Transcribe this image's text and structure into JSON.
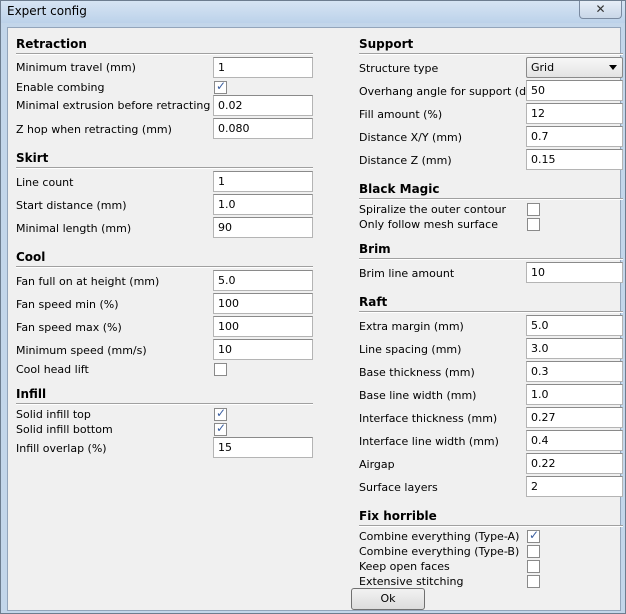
{
  "window": {
    "title": "Expert config",
    "close_glyph": "✕"
  },
  "left": {
    "retraction": {
      "title": "Retraction",
      "min_travel": {
        "label": "Minimum travel (mm)",
        "value": "1"
      },
      "enable_combing": {
        "label": "Enable combing",
        "checked": true
      },
      "min_extrusion": {
        "label": "Minimal extrusion before retracting (mm)",
        "value": "0.02"
      },
      "z_hop": {
        "label": "Z hop when retracting (mm)",
        "value": "0.080"
      }
    },
    "skirt": {
      "title": "Skirt",
      "line_count": {
        "label": "Line count",
        "value": "1"
      },
      "start_distance": {
        "label": "Start distance (mm)",
        "value": "1.0"
      },
      "min_length": {
        "label": "Minimal length (mm)",
        "value": "90"
      }
    },
    "cool": {
      "title": "Cool",
      "fan_full_height": {
        "label": "Fan full on at height (mm)",
        "value": "5.0"
      },
      "fan_speed_min": {
        "label": "Fan speed min (%)",
        "value": "100"
      },
      "fan_speed_max": {
        "label": "Fan speed max (%)",
        "value": "100"
      },
      "min_speed": {
        "label": "Minimum speed (mm/s)",
        "value": "10"
      },
      "cool_head_lift": {
        "label": "Cool head lift",
        "checked": false
      }
    },
    "infill": {
      "title": "Infill",
      "solid_top": {
        "label": "Solid infill top",
        "checked": true
      },
      "solid_bottom": {
        "label": "Solid infill bottom",
        "checked": true
      },
      "overlap": {
        "label": "Infill overlap (%)",
        "value": "15"
      }
    }
  },
  "right": {
    "support": {
      "title": "Support",
      "structure_type": {
        "label": "Structure type",
        "value": "Grid"
      },
      "overhang_angle": {
        "label": "Overhang angle for support (deg)",
        "value": "50"
      },
      "fill_amount": {
        "label": "Fill amount (%)",
        "value": "12"
      },
      "distance_xy": {
        "label": "Distance X/Y (mm)",
        "value": "0.7"
      },
      "distance_z": {
        "label": "Distance Z (mm)",
        "value": "0.15"
      }
    },
    "black_magic": {
      "title": "Black Magic",
      "spiralize": {
        "label": "Spiralize the outer contour",
        "checked": false
      },
      "mesh_surface": {
        "label": "Only follow mesh surface",
        "checked": false
      }
    },
    "brim": {
      "title": "Brim",
      "line_amount": {
        "label": "Brim line amount",
        "value": "10"
      }
    },
    "raft": {
      "title": "Raft",
      "extra_margin": {
        "label": "Extra margin (mm)",
        "value": "5.0"
      },
      "line_spacing": {
        "label": "Line spacing (mm)",
        "value": "3.0"
      },
      "base_thickness": {
        "label": "Base thickness (mm)",
        "value": "0.3"
      },
      "base_line_width": {
        "label": "Base line width (mm)",
        "value": "1.0"
      },
      "interface_thickness": {
        "label": "Interface thickness (mm)",
        "value": "0.27"
      },
      "interface_line_width": {
        "label": "Interface line width (mm)",
        "value": "0.4"
      },
      "airgap": {
        "label": "Airgap",
        "value": "0.22"
      },
      "surface_layers": {
        "label": "Surface layers",
        "value": "2"
      }
    },
    "fix_horrible": {
      "title": "Fix horrible",
      "combine_a": {
        "label": "Combine everything (Type-A)",
        "checked": true
      },
      "combine_b": {
        "label": "Combine everything (Type-B)",
        "checked": false
      },
      "keep_open": {
        "label": "Keep open faces",
        "checked": false
      },
      "extensive_stitching": {
        "label": "Extensive stitching",
        "checked": false
      }
    }
  },
  "footer": {
    "ok_label": "Ok"
  },
  "icons": {
    "check": "✓",
    "close": "close-icon",
    "dropdown": "chevron-down-icon"
  }
}
